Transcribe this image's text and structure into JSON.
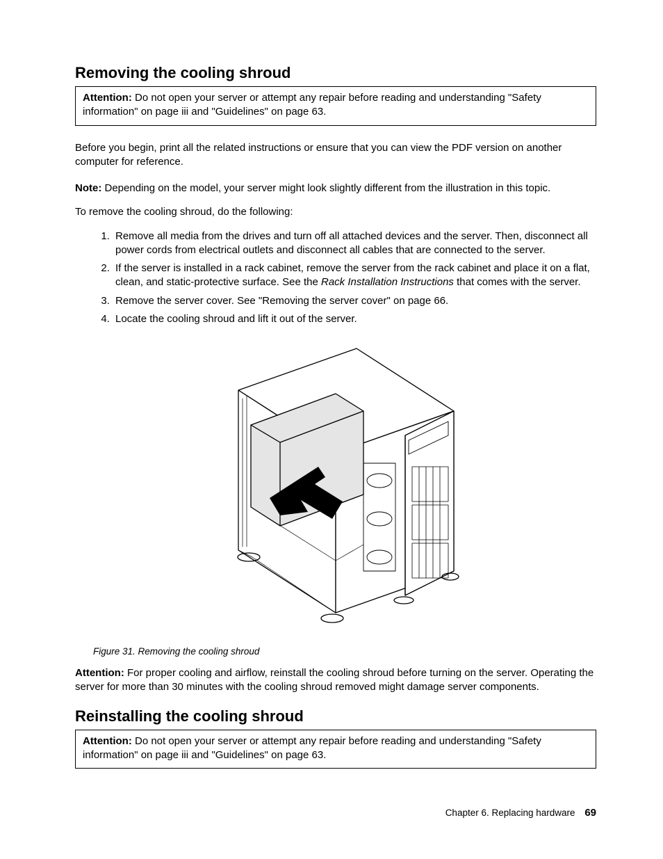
{
  "section1": {
    "heading": "Removing the cooling shroud",
    "attention_label": "Attention:",
    "attention_text": " Do not open your server or attempt any repair before reading and understanding \"Safety information\" on page iii and \"Guidelines\" on page 63.",
    "intro": "Before you begin, print all the related instructions or ensure that you can view the PDF version on another computer for reference.",
    "note_label": "Note:",
    "note_text": " Depending on the model, your server might look slightly different from the illustration in this topic.",
    "lead_in": "To remove the cooling shroud, do the following:",
    "steps": [
      "Remove all media from the drives and turn off all attached devices and the server. Then, disconnect all power cords from electrical outlets and disconnect all cables that are connected to the server.",
      "If the server is installed in a rack cabinet, remove the server from the rack cabinet and place it on a flat, clean, and static-protective surface. See the ",
      "Remove the server cover. See \"Removing the server cover\" on page 66.",
      "Locate the cooling shroud and lift it out of the server."
    ],
    "step2_italic": "Rack Installation Instructions",
    "step2_tail": " that comes with the server.",
    "figure_caption": "Figure 31.  Removing the cooling shroud",
    "post_attention_label": "Attention:",
    "post_attention_text": " For proper cooling and airflow, reinstall the cooling shroud before turning on the server. Operating the server for more than 30 minutes with the cooling shroud removed might damage server components."
  },
  "section2": {
    "heading": "Reinstalling the cooling shroud",
    "attention_label": "Attention:",
    "attention_text": " Do not open your server or attempt any repair before reading and understanding \"Safety information\" on page iii and \"Guidelines\" on page 63."
  },
  "footer": {
    "chapter": "Chapter 6.  Replacing hardware",
    "page": "69"
  }
}
